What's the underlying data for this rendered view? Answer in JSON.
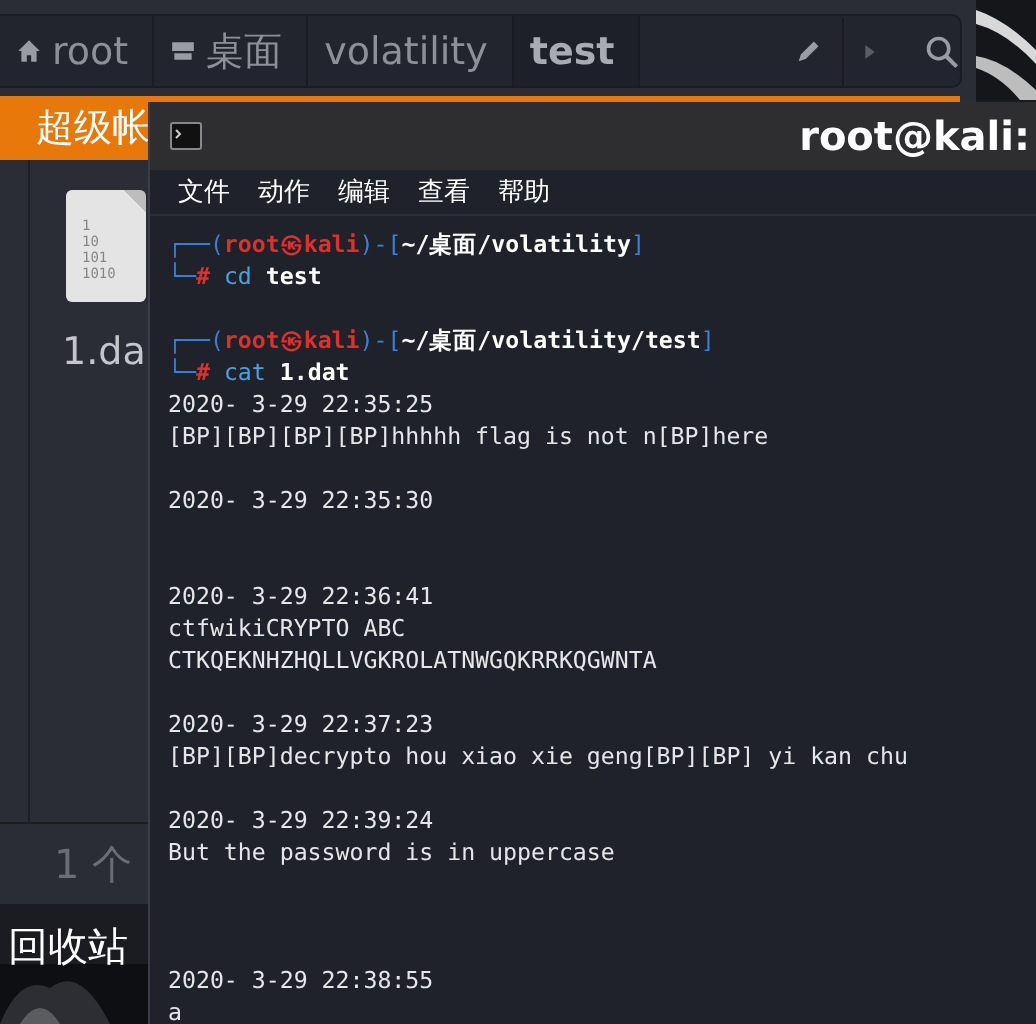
{
  "file_manager": {
    "breadcrumbs": [
      {
        "label": "root",
        "selected": false
      },
      {
        "label": "桌面",
        "selected": false
      },
      {
        "label": "volatility",
        "selected": false
      },
      {
        "label": "test",
        "selected": true
      }
    ],
    "banner": "超级帐",
    "file": {
      "name": "1.da",
      "icon_lines": [
        "1",
        "10",
        "101",
        "1010"
      ]
    },
    "status": "1 个"
  },
  "desktop": {
    "trash_label": "回收站"
  },
  "terminal": {
    "title": "root@kali:",
    "menu": [
      "文件",
      "动作",
      "编辑",
      "查看",
      "帮助"
    ],
    "entries": [
      {
        "kind": "prompt",
        "frame_top": "┌──(",
        "user": "root",
        "at": "㉿",
        "host": "kali",
        "path_open": ")-[",
        "path": "~/桌面/volatility",
        "path_close": "]",
        "frame_bottom": "└─",
        "hash": "#",
        "command": "cd",
        "argument": "test"
      },
      {
        "kind": "blank"
      },
      {
        "kind": "prompt",
        "frame_top": "┌──(",
        "user": "root",
        "at": "㉿",
        "host": "kali",
        "path_open": ")-[",
        "path": "~/桌面/volatility/test",
        "path_close": "]",
        "frame_bottom": "└─",
        "hash": "#",
        "command": "cat",
        "argument": "1.dat"
      },
      {
        "kind": "text",
        "text": "2020- 3-29 22:35:25"
      },
      {
        "kind": "text",
        "text": "[BP][BP][BP][BP]hhhhh flag is not n[BP]here"
      },
      {
        "kind": "blank"
      },
      {
        "kind": "text",
        "text": "2020- 3-29 22:35:30"
      },
      {
        "kind": "blank"
      },
      {
        "kind": "blank"
      },
      {
        "kind": "text",
        "text": "2020- 3-29 22:36:41"
      },
      {
        "kind": "text",
        "text": "ctfwikiCRYPTO ABC"
      },
      {
        "kind": "text",
        "text": "CTKQEKNHZHQLLVGKROLATNWGQKRRKQGWNTA"
      },
      {
        "kind": "blank"
      },
      {
        "kind": "text",
        "text": "2020- 3-29 22:37:23"
      },
      {
        "kind": "text",
        "text": "[BP][BP]decrypto hou xiao xie geng[BP][BP] yi kan chu"
      },
      {
        "kind": "blank"
      },
      {
        "kind": "text",
        "text": "2020- 3-29 22:39:24"
      },
      {
        "kind": "text",
        "text": "But the password is in uppercase"
      },
      {
        "kind": "blank"
      },
      {
        "kind": "blank"
      },
      {
        "kind": "blank"
      },
      {
        "kind": "text",
        "text": "2020- 3-29 22:38:55"
      },
      {
        "kind": "text",
        "text": "a"
      }
    ]
  }
}
